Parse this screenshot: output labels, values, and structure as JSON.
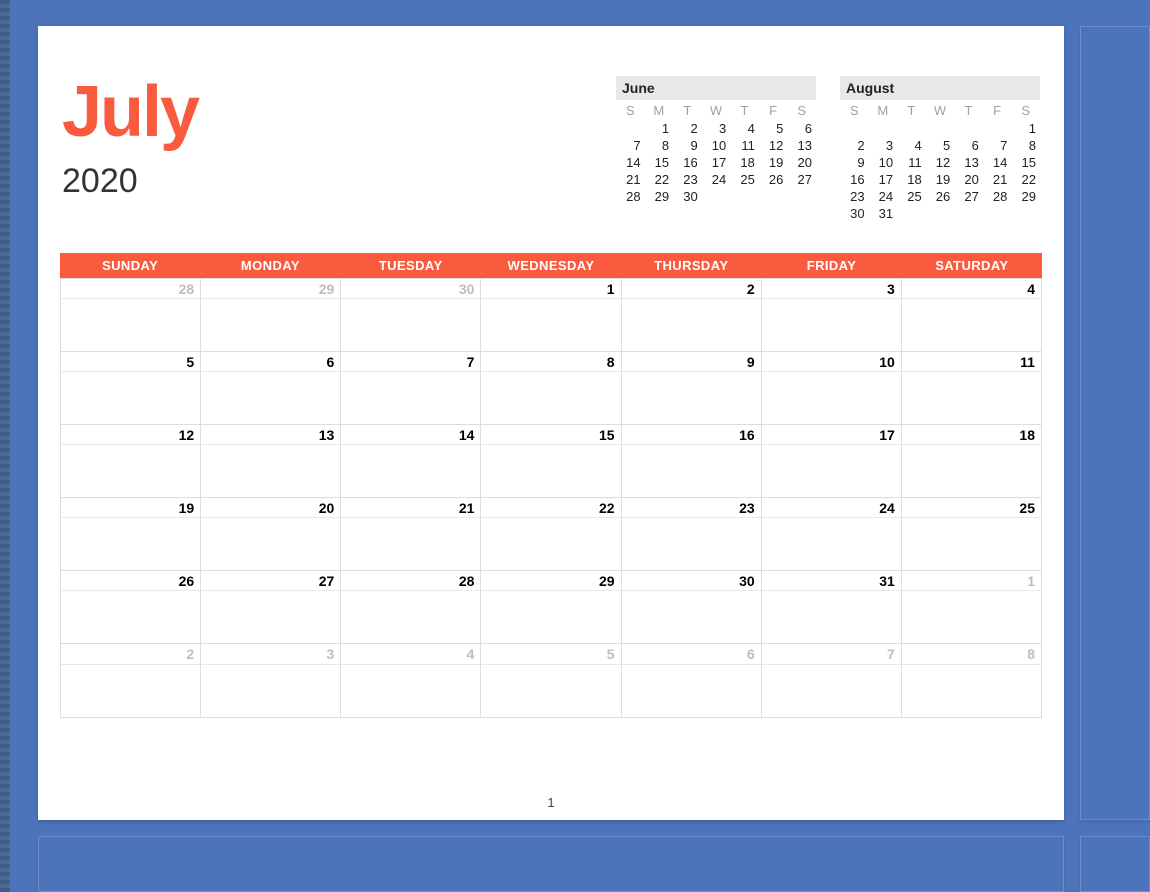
{
  "title": {
    "month": "July",
    "year": "2020"
  },
  "page_number": "1",
  "weekday_headers": [
    "SUNDAY",
    "MONDAY",
    "TUESDAY",
    "WEDNESDAY",
    "THURSDAY",
    "FRIDAY",
    "SATURDAY"
  ],
  "mini_weekday_headers": [
    "S",
    "M",
    "T",
    "W",
    "T",
    "F",
    "S"
  ],
  "mini_prev": {
    "name": "June",
    "rows": [
      [
        "",
        "1",
        "2",
        "3",
        "4",
        "5",
        "6"
      ],
      [
        "7",
        "8",
        "9",
        "10",
        "11",
        "12",
        "13"
      ],
      [
        "14",
        "15",
        "16",
        "17",
        "18",
        "19",
        "20"
      ],
      [
        "21",
        "22",
        "23",
        "24",
        "25",
        "26",
        "27"
      ],
      [
        "28",
        "29",
        "30",
        "",
        "",
        "",
        ""
      ],
      [
        "",
        "",
        "",
        "",
        "",
        "",
        ""
      ]
    ]
  },
  "mini_next": {
    "name": "August",
    "rows": [
      [
        "",
        "",
        "",
        "",
        "",
        "",
        "1"
      ],
      [
        "2",
        "3",
        "4",
        "5",
        "6",
        "7",
        "8"
      ],
      [
        "9",
        "10",
        "11",
        "12",
        "13",
        "14",
        "15"
      ],
      [
        "16",
        "17",
        "18",
        "19",
        "20",
        "21",
        "22"
      ],
      [
        "23",
        "24",
        "25",
        "26",
        "27",
        "28",
        "29"
      ],
      [
        "30",
        "31",
        "",
        "",
        "",
        "",
        ""
      ]
    ]
  },
  "main_grid": [
    [
      {
        "d": "28",
        "out": true
      },
      {
        "d": "29",
        "out": true
      },
      {
        "d": "30",
        "out": true
      },
      {
        "d": "1"
      },
      {
        "d": "2"
      },
      {
        "d": "3"
      },
      {
        "d": "4"
      }
    ],
    [
      {
        "d": "5"
      },
      {
        "d": "6"
      },
      {
        "d": "7"
      },
      {
        "d": "8"
      },
      {
        "d": "9"
      },
      {
        "d": "10"
      },
      {
        "d": "11"
      }
    ],
    [
      {
        "d": "12"
      },
      {
        "d": "13"
      },
      {
        "d": "14"
      },
      {
        "d": "15"
      },
      {
        "d": "16"
      },
      {
        "d": "17"
      },
      {
        "d": "18"
      }
    ],
    [
      {
        "d": "19"
      },
      {
        "d": "20"
      },
      {
        "d": "21"
      },
      {
        "d": "22"
      },
      {
        "d": "23"
      },
      {
        "d": "24"
      },
      {
        "d": "25"
      }
    ],
    [
      {
        "d": "26"
      },
      {
        "d": "27"
      },
      {
        "d": "28"
      },
      {
        "d": "29"
      },
      {
        "d": "30"
      },
      {
        "d": "31"
      },
      {
        "d": "1",
        "out": true
      }
    ],
    [
      {
        "d": "2",
        "out": true
      },
      {
        "d": "3",
        "out": true
      },
      {
        "d": "4",
        "out": true
      },
      {
        "d": "5",
        "out": true
      },
      {
        "d": "6",
        "out": true
      },
      {
        "d": "7",
        "out": true
      },
      {
        "d": "8",
        "out": true
      }
    ]
  ]
}
